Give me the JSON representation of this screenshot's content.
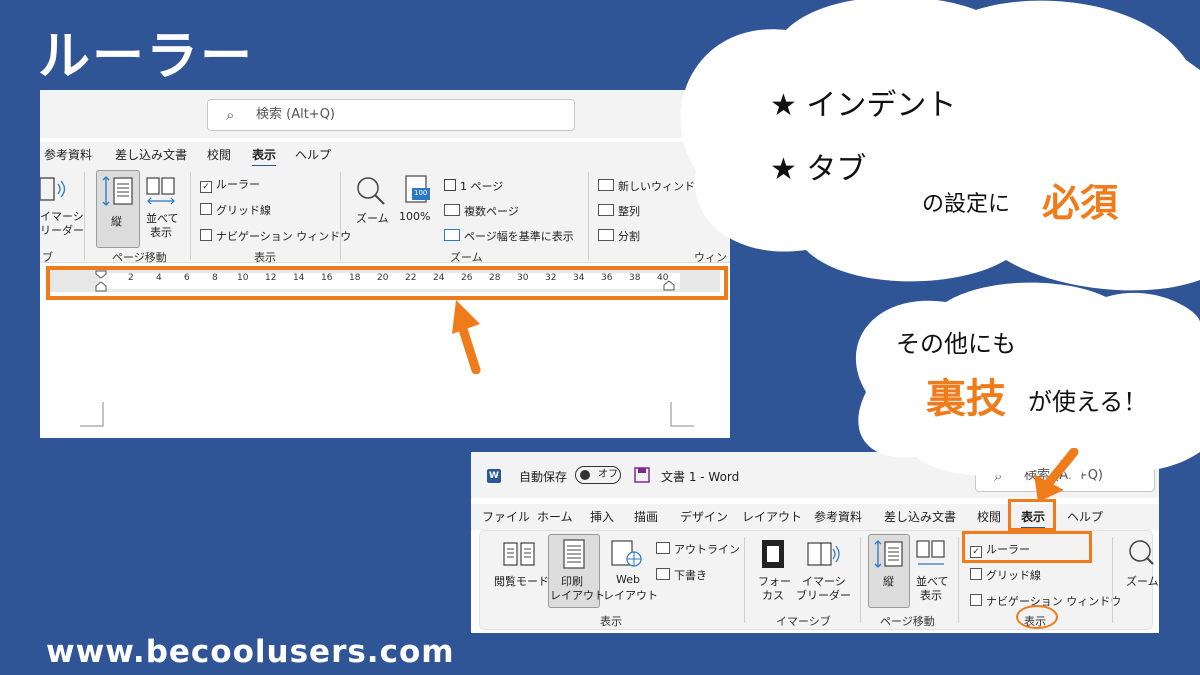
{
  "page": {
    "title": "ルーラー",
    "footer_url": "www.becoolusers.com"
  },
  "colors": {
    "background": "#2f5597",
    "accent_orange": "#f07b1a",
    "word_blue": "#2b579a"
  },
  "callout_top": {
    "lines": [
      "★ インデント",
      "★ タブ"
    ],
    "suffix_text": "の設定に",
    "emphasis": "必須"
  },
  "callout_bottom": {
    "line1": "その他にも",
    "emphasis": "裏技",
    "suffix": "が使える！"
  },
  "window_top": {
    "search_placeholder": "検索 (Alt+Q)",
    "tabs": [
      "参考資料",
      "差し込み文書",
      "校閲",
      "表示",
      "ヘルプ"
    ],
    "active_tab": "表示",
    "ribbon": {
      "immersive_partial_line1": "イマーシ",
      "immersive_partial_line2": "リーダー",
      "group_immersive_partial": "ブ",
      "vertical_label": "縦",
      "side_by_side_line1": "並べて",
      "side_by_side_line2": "表示",
      "group_page_move": "ページ移動",
      "ruler_label": "ルーラー",
      "gridlines_label": "グリッド線",
      "navigation_label": "ナビゲーション ウィンドウ",
      "group_show": "表示",
      "zoom_label": "ズーム",
      "zoom100_label": "100%",
      "zoom100_icon_text": "100",
      "one_page": "1 ページ",
      "multiple_pages": "複数ページ",
      "page_width": "ページ幅を基準に表示",
      "group_zoom": "ズーム",
      "new_window": "新しいウィンドウ",
      "arrange_all": "整列",
      "split": "分割",
      "group_window_partial": "ウィンド"
    },
    "ruler_ticks": [
      "2",
      "4",
      "6",
      "8",
      "10",
      "12",
      "14",
      "16",
      "18",
      "20",
      "22",
      "24",
      "26",
      "28",
      "30",
      "32",
      "34",
      "36",
      "38",
      "40"
    ]
  },
  "window_bottom": {
    "autosave_label": "自動保存",
    "autosave_state": "オフ",
    "document_title": "文書 1  -  Word",
    "search_placeholder": "検索 (Alt+Q)",
    "tabs": [
      "ファイル",
      "ホーム",
      "挿入",
      "描画",
      "デザイン",
      "レイアウト",
      "参考資料",
      "差し込み文書",
      "校閲",
      "表示",
      "ヘルプ"
    ],
    "active_tab": "表示",
    "ribbon": {
      "read_mode": "閲覧モード",
      "print_layout_line1": "印刷",
      "print_layout_line2": "レイアウト",
      "web_layout_line1": "Web",
      "web_layout_line2": "レイアウト",
      "outline": "アウトライン",
      "draft": "下書き",
      "group_views": "表示",
      "focus_line1": "フォー",
      "focus_line2": "カス",
      "immersive_reader_line1": "イマーシ",
      "immersive_reader_line2": "ブリーダー",
      "group_immersive": "イマーシブ",
      "vertical": "縦",
      "side_by_side_line1": "並べて",
      "side_by_side_line2": "表示",
      "group_page_move": "ページ移動",
      "ruler_label": "ルーラー",
      "ruler_checked": true,
      "gridlines_label": "グリッド線",
      "navigation_label": "ナビゲーション ウィンドウ",
      "group_show": "表示",
      "zoom_partial": "ズーム"
    }
  }
}
